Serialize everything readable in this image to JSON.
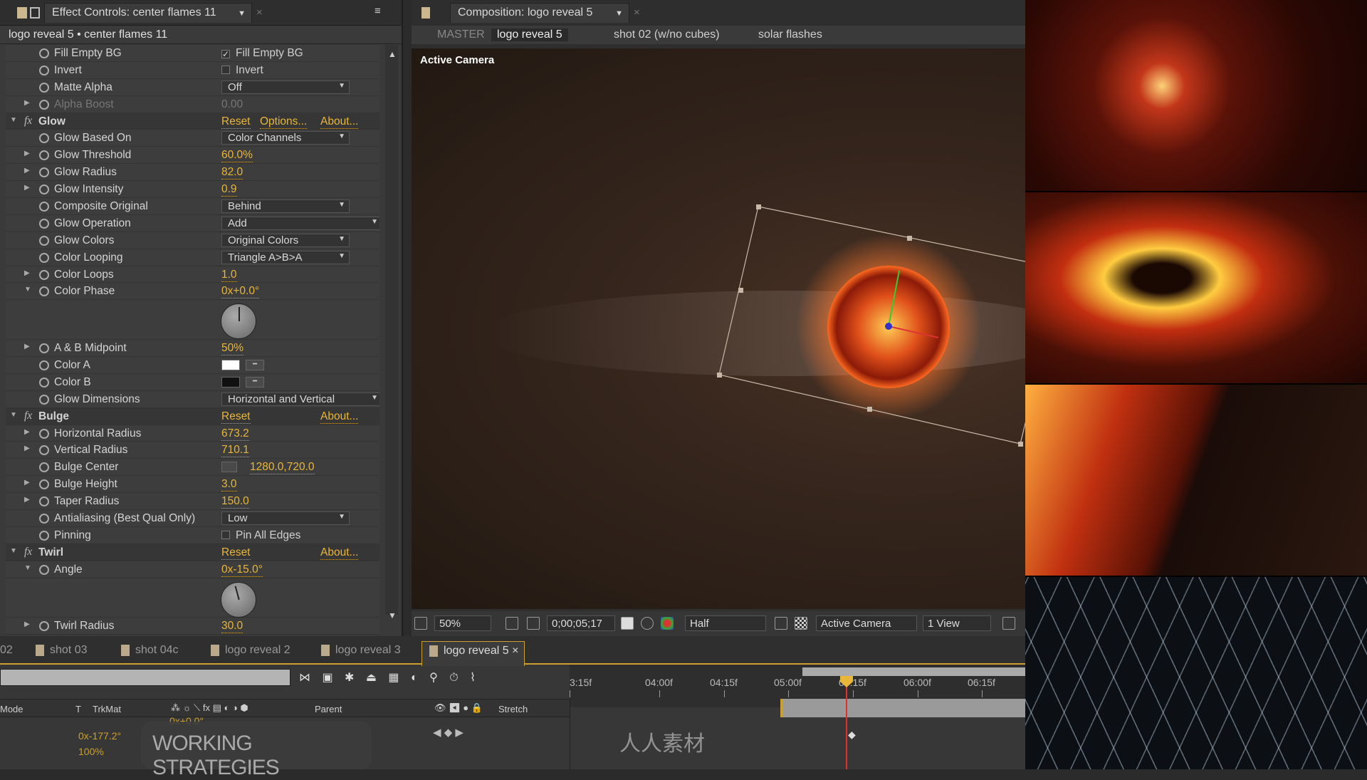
{
  "effect_controls": {
    "tab_title": "Effect Controls: center flames 11",
    "breadcrumb": "logo reveal 5 • center flames 11",
    "rows": [
      {
        "type": "prop",
        "name": "Fill Empty BG",
        "kind": "checkbox",
        "checked": true,
        "value": "Fill Empty BG"
      },
      {
        "type": "prop",
        "name": "Invert",
        "kind": "checkbox",
        "checked": false,
        "value": "Invert"
      },
      {
        "type": "prop",
        "name": "Matte Alpha",
        "kind": "dropdown",
        "value": "Off",
        "w": 180
      },
      {
        "type": "prop",
        "name": "Alpha Boost",
        "kind": "text",
        "value": "0.00",
        "twirl": true,
        "dim": true
      },
      {
        "type": "fx",
        "name": "Glow",
        "links": [
          "Reset",
          "Options...",
          "About..."
        ]
      },
      {
        "type": "prop",
        "name": "Glow Based On",
        "kind": "dropdown",
        "value": "Color Channels",
        "w": 180
      },
      {
        "type": "prop",
        "name": "Glow Threshold",
        "kind": "yellow",
        "value": "60.0%",
        "twirl": true
      },
      {
        "type": "prop",
        "name": "Glow Radius",
        "kind": "yellow",
        "value": "82.0",
        "twirl": true
      },
      {
        "type": "prop",
        "name": "Glow Intensity",
        "kind": "yellow",
        "value": "0.9",
        "twirl": true
      },
      {
        "type": "prop",
        "name": "Composite Original",
        "kind": "dropdown",
        "value": "Behind",
        "w": 180
      },
      {
        "type": "prop",
        "name": "Glow Operation",
        "kind": "dropdown",
        "value": "Add",
        "w": 226
      },
      {
        "type": "prop",
        "name": "Glow Colors",
        "kind": "dropdown",
        "value": "Original Colors",
        "w": 180
      },
      {
        "type": "prop",
        "name": "Color Looping",
        "kind": "dropdown",
        "value": "Triangle A>B>A",
        "w": 180
      },
      {
        "type": "prop",
        "name": "Color Loops",
        "kind": "yellow",
        "value": "1.0",
        "twirl": true
      },
      {
        "type": "prop",
        "name": "Color Phase",
        "kind": "yellow",
        "value": "0x+0.0°",
        "twirl": true,
        "open": true
      },
      {
        "type": "dial",
        "angle": 0
      },
      {
        "type": "prop",
        "name": "A & B Midpoint",
        "kind": "yellow",
        "value": "50%",
        "twirl": true
      },
      {
        "type": "prop",
        "name": "Color A",
        "kind": "color",
        "color": "#ffffff"
      },
      {
        "type": "prop",
        "name": "Color B",
        "kind": "color",
        "color": "#111111"
      },
      {
        "type": "prop",
        "name": "Glow Dimensions",
        "kind": "dropdown",
        "value": "Horizontal and Vertical",
        "w": 226
      },
      {
        "type": "fx",
        "name": "Bulge",
        "links": [
          "Reset",
          "",
          "About..."
        ]
      },
      {
        "type": "prop",
        "name": "Horizontal Radius",
        "kind": "yellow",
        "value": "673.2",
        "twirl": true
      },
      {
        "type": "prop",
        "name": "Vertical Radius",
        "kind": "yellow",
        "value": "710.1",
        "twirl": true
      },
      {
        "type": "prop",
        "name": "Bulge Center",
        "kind": "point",
        "value": "1280.0,720.0"
      },
      {
        "type": "prop",
        "name": "Bulge Height",
        "kind": "yellow",
        "value": "3.0",
        "twirl": true
      },
      {
        "type": "prop",
        "name": "Taper Radius",
        "kind": "yellow",
        "value": "150.0",
        "twirl": true
      },
      {
        "type": "prop",
        "name": "Antialiasing (Best Qual Only)",
        "kind": "dropdown",
        "value": "Low",
        "w": 180
      },
      {
        "type": "prop",
        "name": "Pinning",
        "kind": "checkbox",
        "checked": false,
        "value": "Pin All Edges"
      },
      {
        "type": "fx",
        "name": "Twirl",
        "links": [
          "Reset",
          "",
          "About..."
        ]
      },
      {
        "type": "prop",
        "name": "Angle",
        "kind": "yellow",
        "value": "0x-15.0°",
        "twirl": true,
        "open": true
      },
      {
        "type": "dial",
        "angle": -15
      },
      {
        "type": "prop",
        "name": "Twirl Radius",
        "kind": "yellow",
        "value": "30.0",
        "twirl": true
      }
    ]
  },
  "composition": {
    "tab_title": "Composition: logo reveal 5",
    "breadcrumbs": [
      "MASTER",
      "logo reveal 5",
      "shot 02 (w/no cubes)",
      "solar flashes"
    ],
    "viewer_label": "Active Camera",
    "toolbar": {
      "zoom": "50%",
      "timecode": "0;00;05;17",
      "resolution": "Half",
      "camera": "Active Camera",
      "views": "1 View"
    }
  },
  "timeline": {
    "tabs": [
      "02",
      "shot 03",
      "shot 04c",
      "logo reveal 2",
      "logo reveal 3",
      "logo reveal 5"
    ],
    "active_tab": "logo reveal 5",
    "columns": {
      "mode": "Mode",
      "t": "T",
      "trkmat": "TrkMat",
      "parent": "Parent",
      "stretch": "Stretch"
    },
    "ruler": [
      "3:15f",
      "04:00f",
      "04:15f",
      "05:00f",
      "05:15f",
      "06:00f",
      "06:15f"
    ],
    "layer_values": [
      "0x+0.0°",
      "0x-177.2°",
      "100%"
    ],
    "overlay_title": "WORKING STRATEGIES",
    "watermark": "人人素材"
  },
  "colors": {
    "accent": "#e8b73a",
    "playhead": "#e03030"
  }
}
